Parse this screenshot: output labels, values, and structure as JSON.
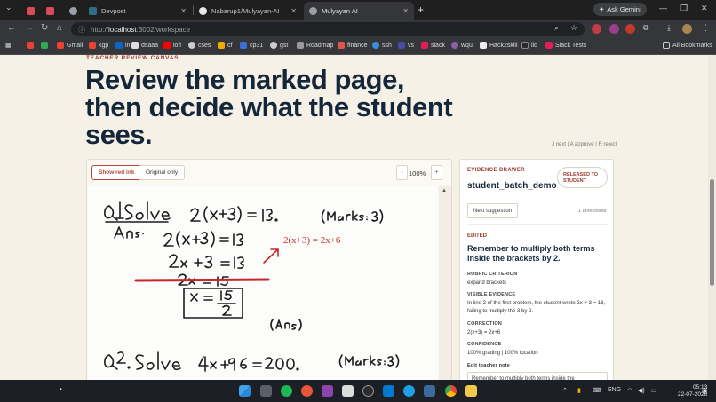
{
  "browser": {
    "tabs": [
      {
        "label": "Devpost",
        "active": false
      },
      {
        "label": "Nabarup1/Mulyayan-AI",
        "active": false
      },
      {
        "label": "Mulyayan AI",
        "active": true
      }
    ],
    "ask_gemini": "Ask Gemini",
    "url_prefix": "http://",
    "url_host": "localhost",
    "url_path": ":3002/workspace",
    "all_bookmarks": "All Bookmarks",
    "bookmarks": [
      "Gmail",
      "kgp",
      "in",
      "dsaaa",
      "lofi",
      "cses",
      "cf",
      "cp31",
      "gst",
      "Roadmap",
      "finance",
      "ssh",
      "vs",
      "slack",
      "wqu",
      "Hack2skill",
      "lld",
      "Slack Tests"
    ]
  },
  "page": {
    "eyebrow": "TEACHER REVIEW CANVAS",
    "headline": "Review the marked page, then decide what the student sees.",
    "shortcuts": "J next | A approve | R reject",
    "toolbar": {
      "show_red_ink": "Show red ink",
      "original_only": "Original only",
      "zoom_out": "-",
      "zoom_level": "100%",
      "zoom_in": "+"
    }
  },
  "drawer": {
    "eyebrow": "EVIDENCE DRAWER",
    "batch": "student_batch_demo",
    "badge": "RELEASED TO STUDENT",
    "next_suggestion": "Next suggestion",
    "unresolved": "1 unresolved",
    "status": "EDITED",
    "comment": "Remember to multiply both terms inside the brackets by 2.",
    "rubric_label": "RUBRIC CRITERION",
    "rubric_value": "expand brackets",
    "evidence_label": "VISIBLE EVIDENCE",
    "evidence_value": "In line 2 of the first problem, the student wrote 2x + 3 = 18, failing to multiply the 3 by 2.",
    "correction_label": "CORRECTION",
    "correction_value": "2(x+3) = 2x+6",
    "confidence_label": "CONFIDENCE",
    "confidence_value": "100% grading | 100% location",
    "edit_note_label": "Edit teacher note",
    "edit_note_value": "Remember to multiply both terms inside the"
  },
  "taskbar": {
    "language": "ENG",
    "time": "05:13",
    "date": "22-07-2026"
  }
}
